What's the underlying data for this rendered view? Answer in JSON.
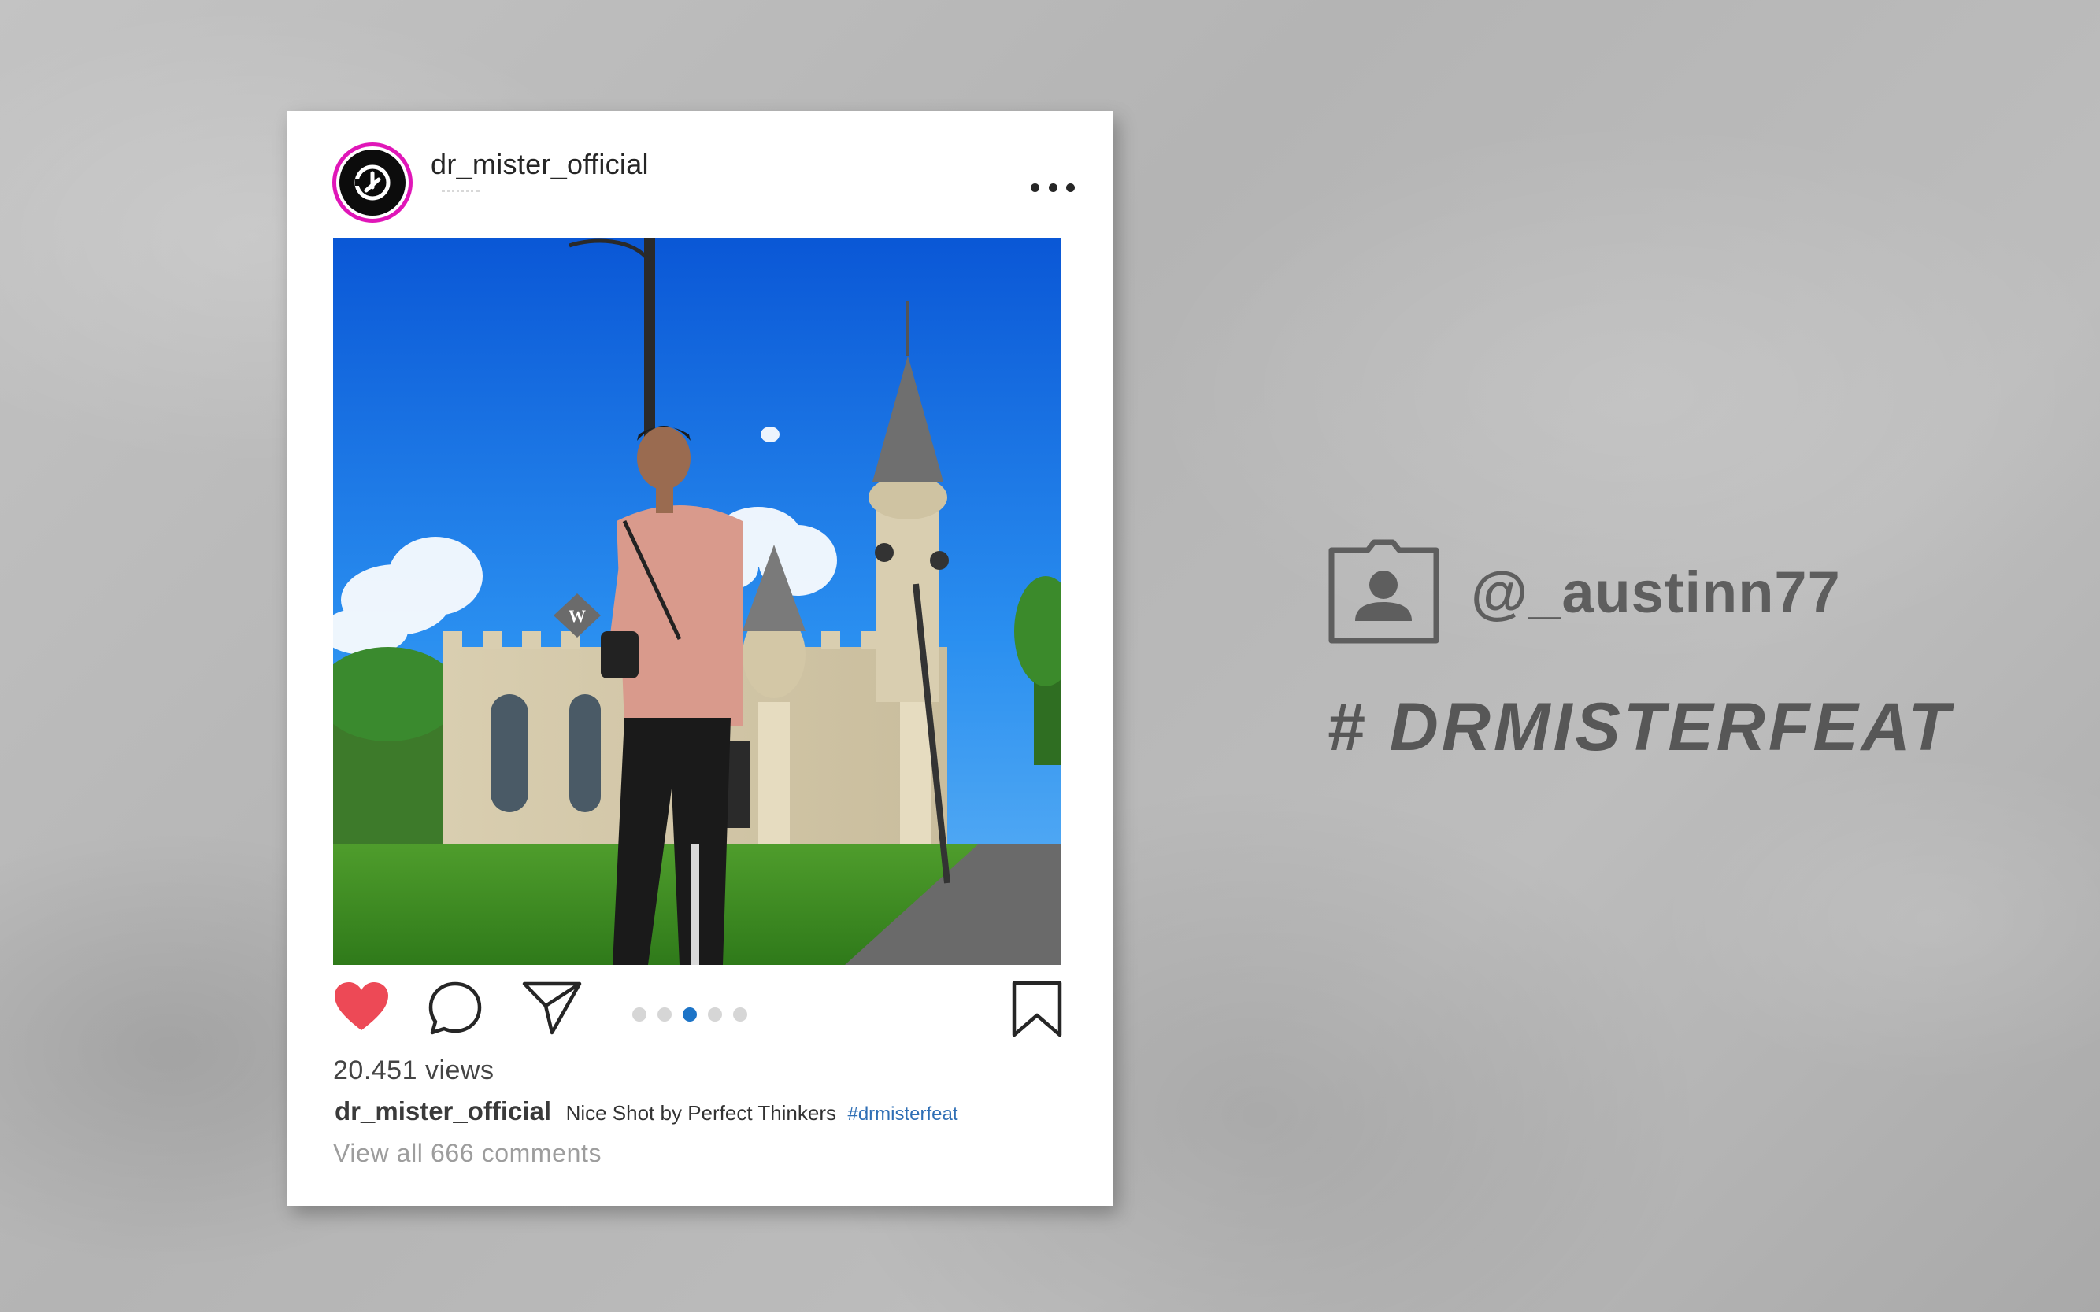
{
  "post": {
    "username": "dr_mister_official",
    "views": "20.451 views",
    "caption_user": "dr_mister_official",
    "caption_text": "Nice Shot by Perfect Thinkers",
    "caption_tag": "#drmisterfeat",
    "comments_link": "View all 666 comments",
    "carousel": {
      "count": 5,
      "active_index": 2
    }
  },
  "icons": {
    "more": "more-horizontal-icon",
    "like": "heart-icon",
    "comment": "comment-bubble-icon",
    "share": "send-paper-plane-icon",
    "save": "bookmark-icon",
    "profile": "profile-card-icon"
  },
  "colors": {
    "avatar_ring": "#e016b8",
    "heart": "#ed4956",
    "active_dot": "#1d74c7",
    "hashtag_link": "#2f6fb5",
    "side_text": "#5e5e5e"
  },
  "side": {
    "handle": "@_austinn77",
    "hashtag": "# DRMISTERFEAT"
  }
}
